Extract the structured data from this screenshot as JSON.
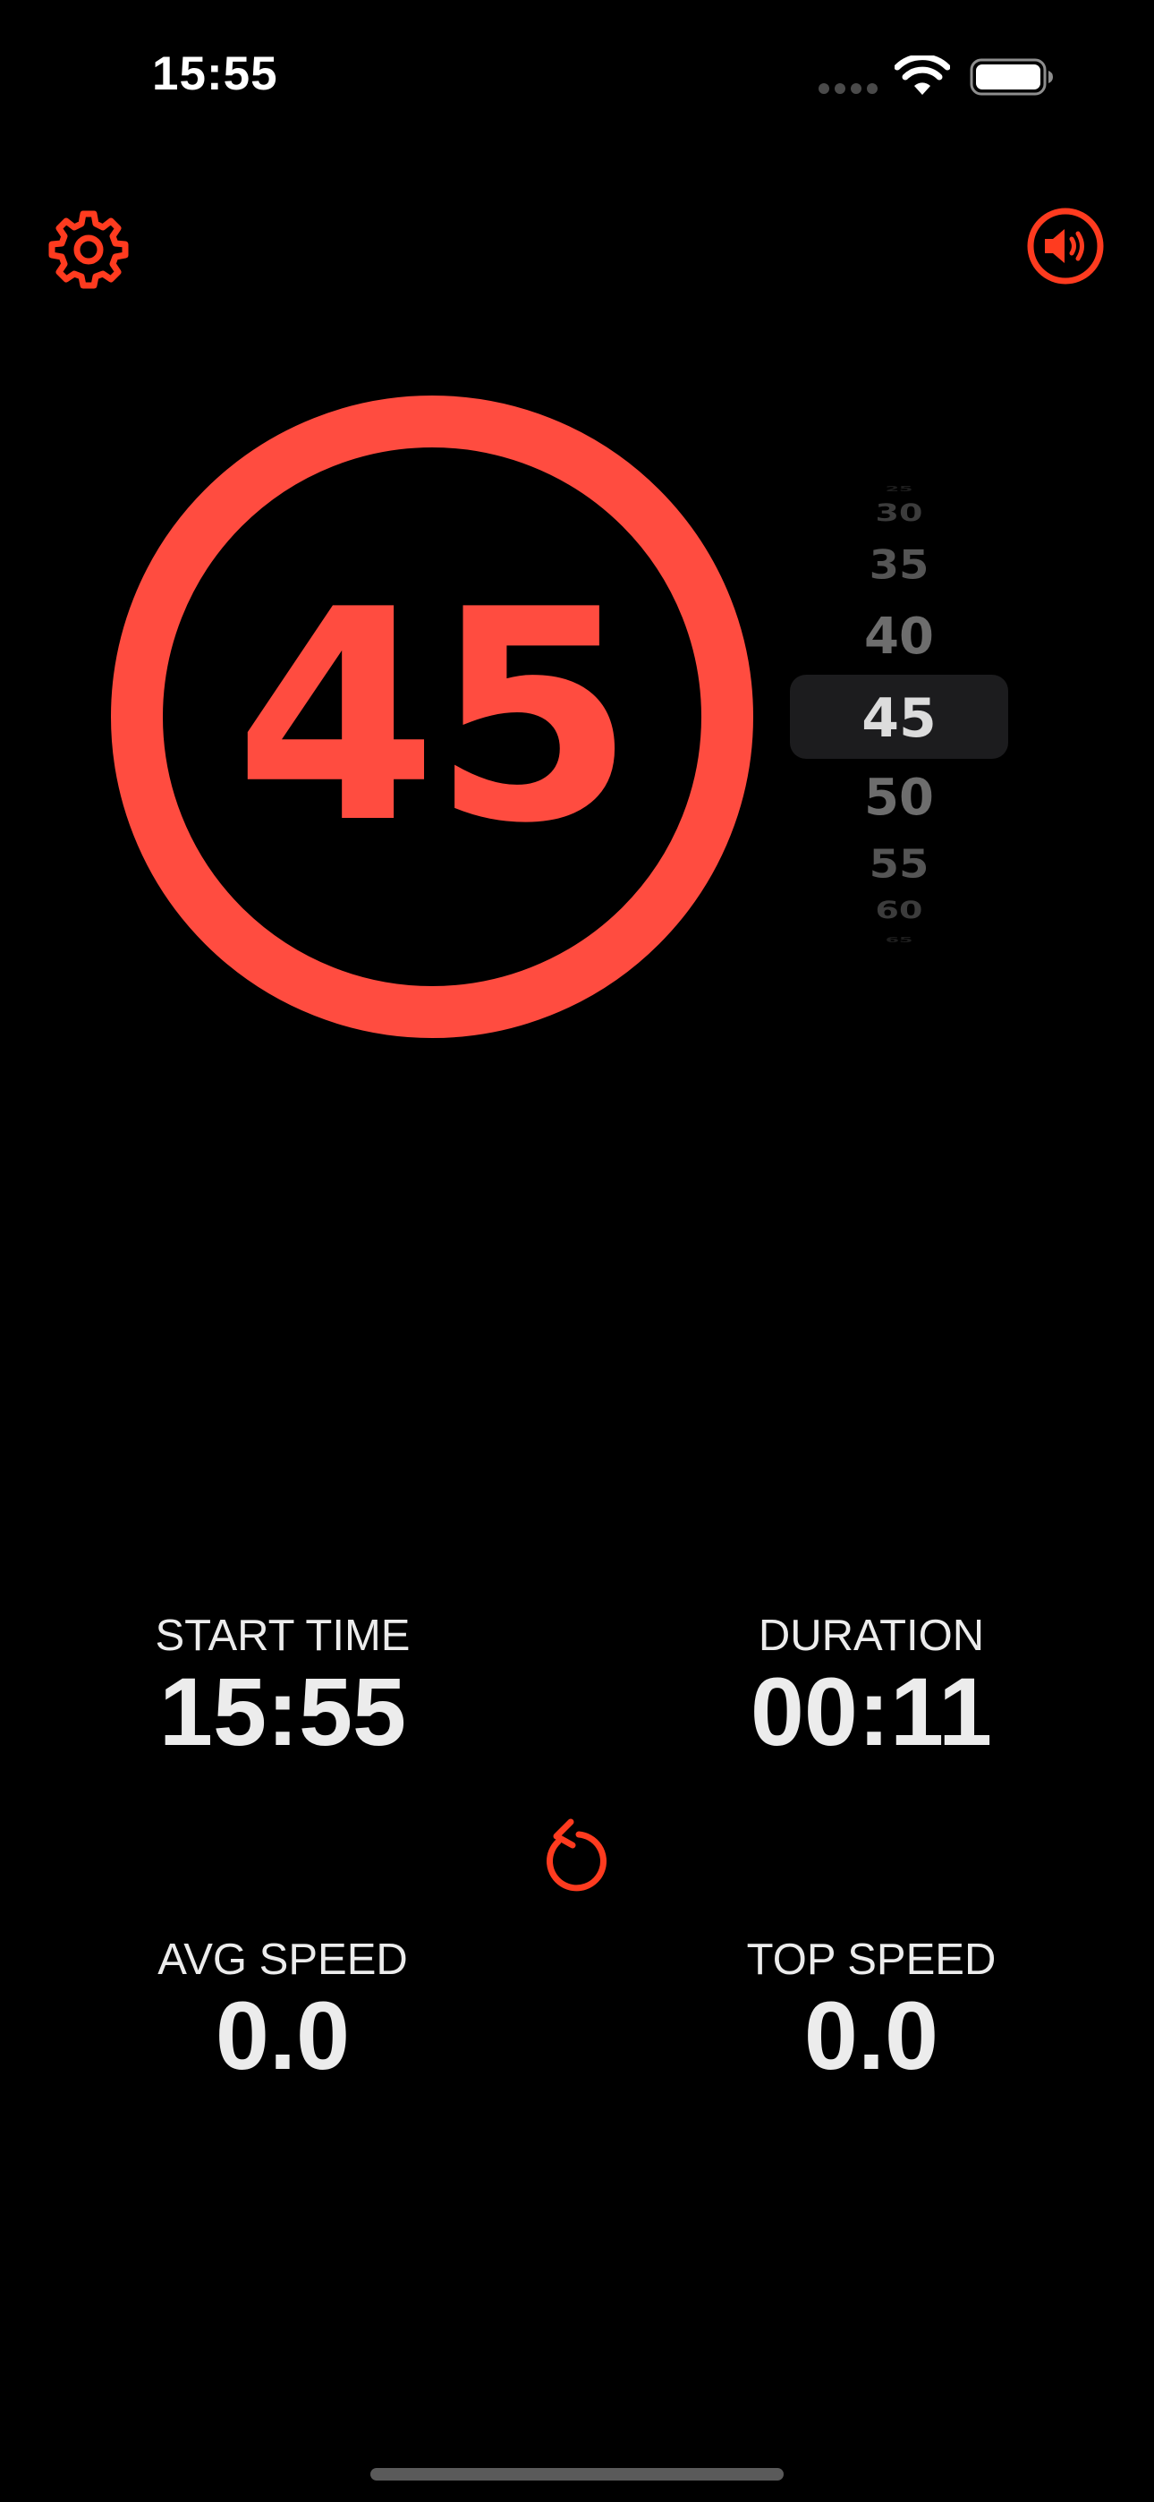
{
  "status_bar": {
    "time": "15:55"
  },
  "controls": {
    "settings_icon": "gear-icon",
    "sound_icon": "speaker-wave-icon",
    "reset_icon": "counterclockwise-arrow-icon"
  },
  "speed_limit": {
    "value": "45"
  },
  "picker": {
    "items": [
      "25",
      "30",
      "35",
      "40",
      "45",
      "50",
      "55",
      "60",
      "65"
    ],
    "selected": "45"
  },
  "stats": {
    "start_time": {
      "label": "START TIME",
      "value": "15:55"
    },
    "duration": {
      "label": "DURATION",
      "value": "00:11"
    },
    "avg_speed": {
      "label": "AVG SPEED",
      "value": "0.0"
    },
    "top_speed": {
      "label": "TOP SPEED",
      "value": "0.0"
    }
  },
  "colors": {
    "accent": "#ff4c40",
    "icon_accent": "#ff3b1f",
    "background": "#000000",
    "text": "#ececec"
  }
}
